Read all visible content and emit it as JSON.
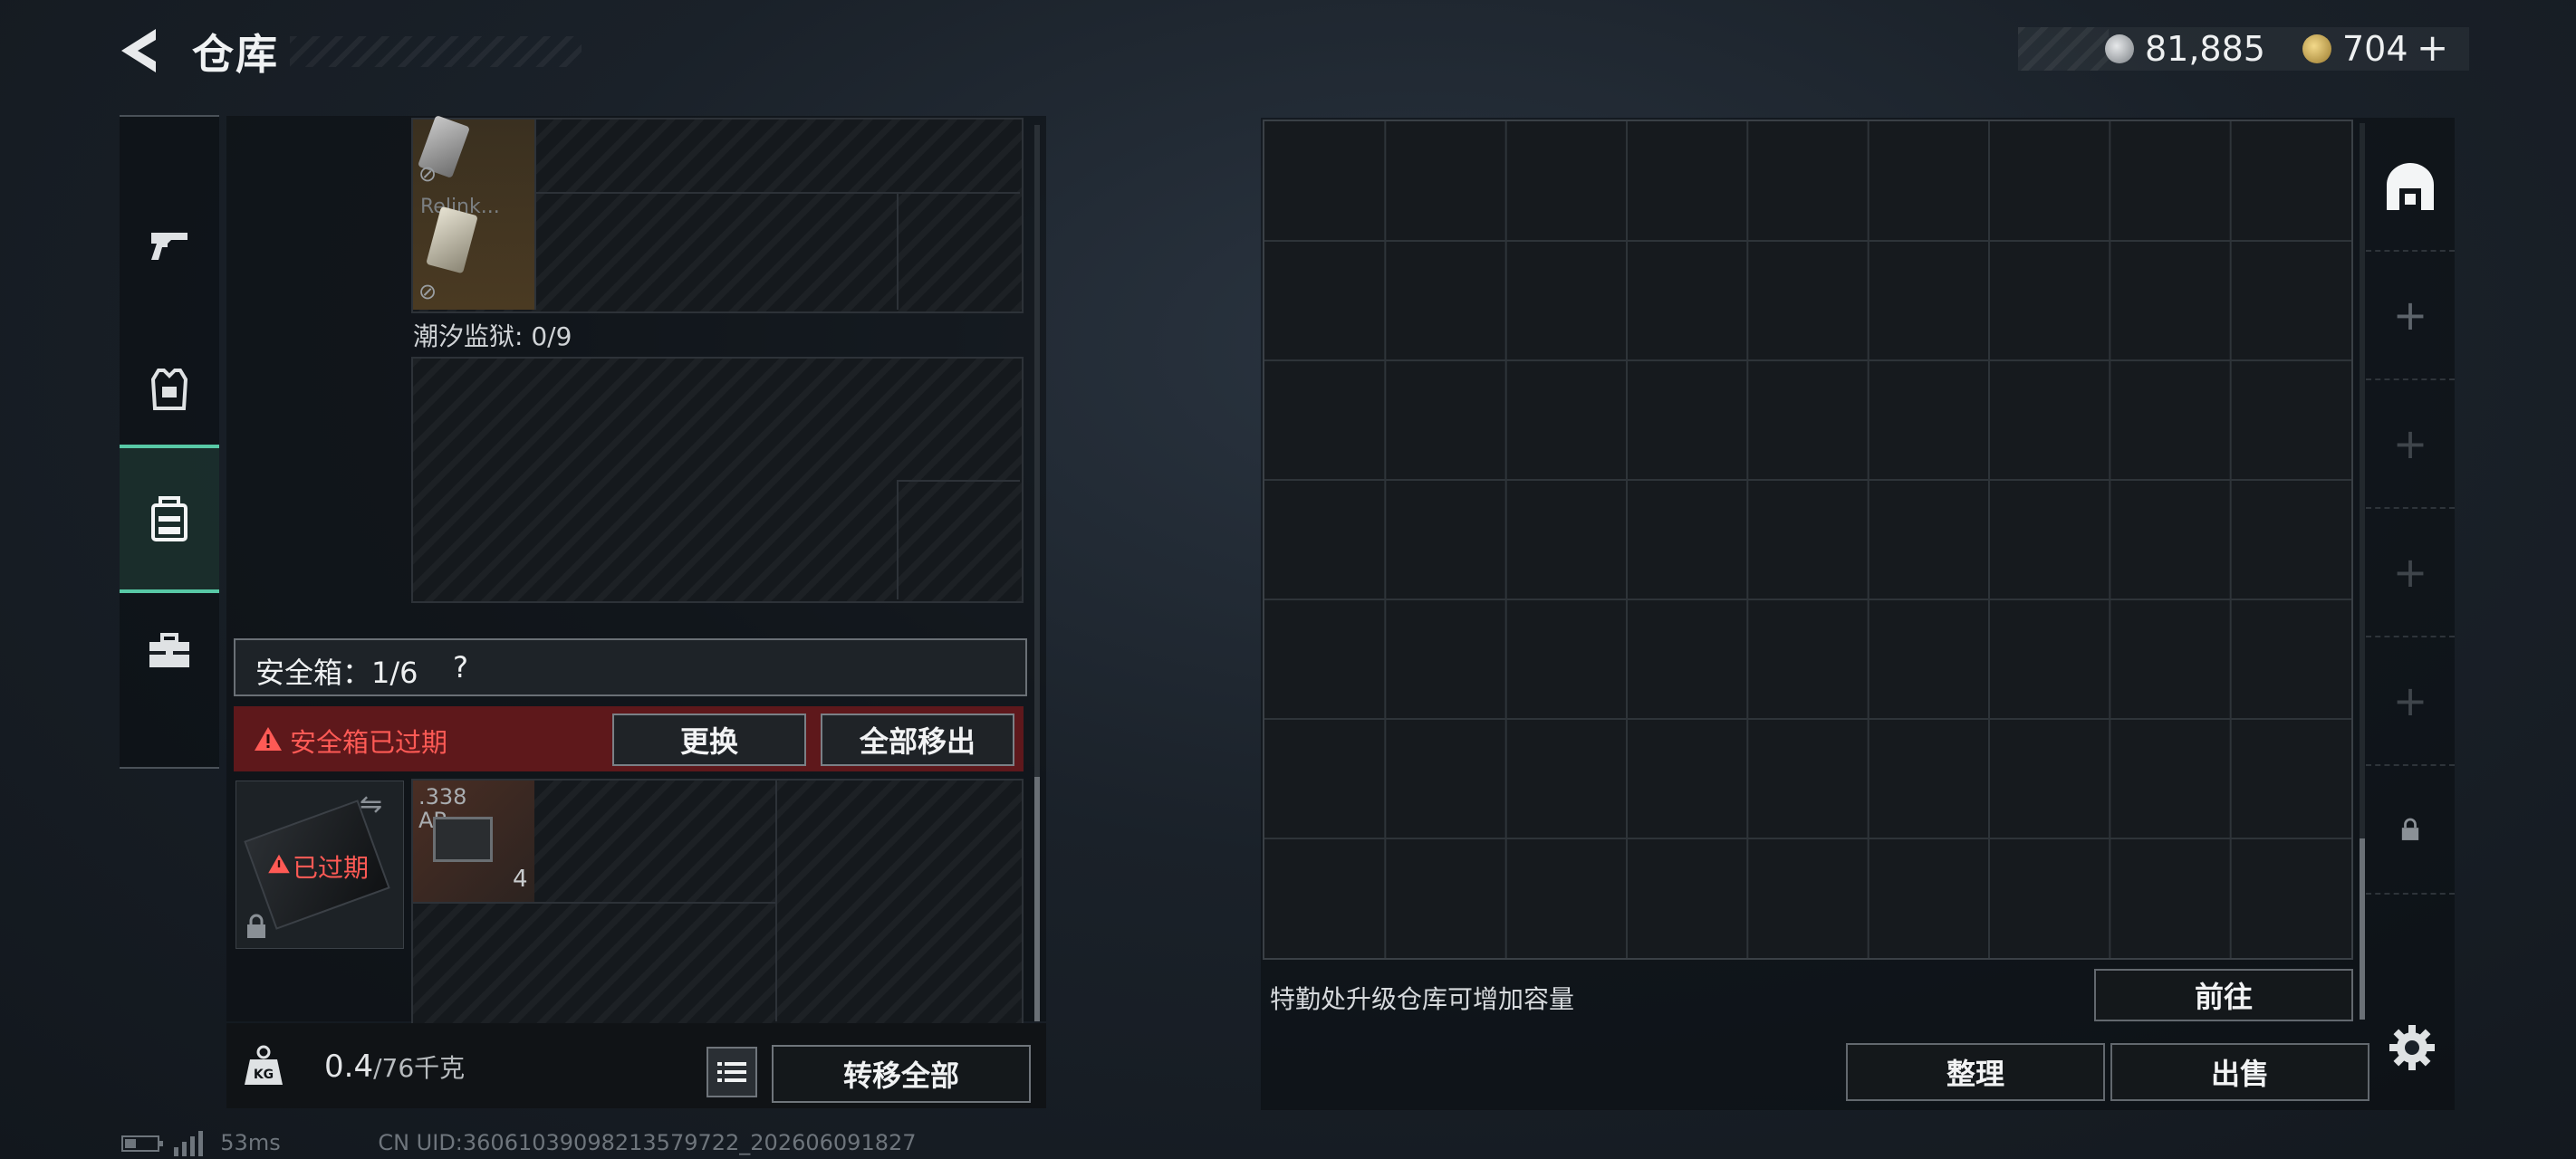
{
  "header": {
    "title": "仓库",
    "currency": [
      {
        "icon": "silver-coin-icon",
        "value": "81,885"
      },
      {
        "icon": "gold-coin-icon",
        "value": "704"
      }
    ],
    "add_symbol": "+"
  },
  "tabs": [
    {
      "name": "weapons",
      "icon": "pistol-icon"
    },
    {
      "name": "armor",
      "icon": "vest-icon"
    },
    {
      "name": "backpack",
      "icon": "backpack-icon",
      "active": true
    },
    {
      "name": "items",
      "icon": "toolbox-icon"
    }
  ],
  "left": {
    "item_label": "Relink...",
    "container_label": "潮汐监狱: 0/9",
    "safe_box_label": "安全箱：1/6",
    "help_symbol": "?",
    "expired_message": "安全箱已过期",
    "replace_button": "更换",
    "remove_all_button": "全部移出",
    "safebox_status": "已过期",
    "ammo": {
      "caliber": ".338",
      "type": "AP",
      "count": "4"
    },
    "weight_value": "0.4",
    "weight_capacity": "/76千克",
    "transfer_all_button": "转移全部"
  },
  "stash": {
    "columns": 9,
    "rows": 7,
    "upgrade_hint": "特勤处升级仓库可增加容量",
    "goto_button": "前往",
    "sort_button": "整理",
    "sell_button": "出售"
  },
  "side_icons": [
    "stash-house-icon",
    "plus-icon",
    "plus-icon",
    "plus-icon",
    "plus-icon",
    "lock-icon"
  ],
  "footer": {
    "ping": "53ms",
    "uid": "CN UID:3606103909821357972​2_202606091827"
  },
  "colors": {
    "accent": "#58c9a6",
    "warning": "#ff5a55",
    "expired_bg": "#781a1c"
  }
}
